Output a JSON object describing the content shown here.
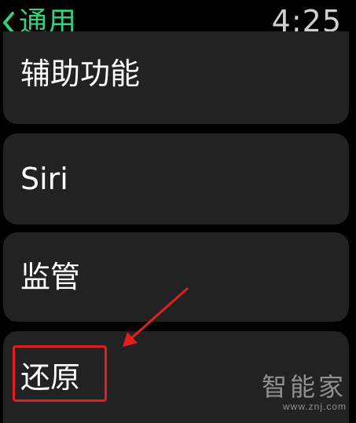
{
  "header": {
    "back_label": "通用",
    "time": "4:25"
  },
  "settings_list": {
    "items": [
      {
        "label": "辅助功能"
      },
      {
        "label": "Siri"
      },
      {
        "label": "监管"
      },
      {
        "label": "还原"
      }
    ]
  },
  "annotation": {
    "highlight_color": "#e02020",
    "highlighted_item": "还原"
  },
  "watermark": {
    "logo_text": "智能家",
    "url": "www.znj.com"
  },
  "colors": {
    "accent": "#33d17a",
    "background": "#000000",
    "cell": "#222222"
  }
}
